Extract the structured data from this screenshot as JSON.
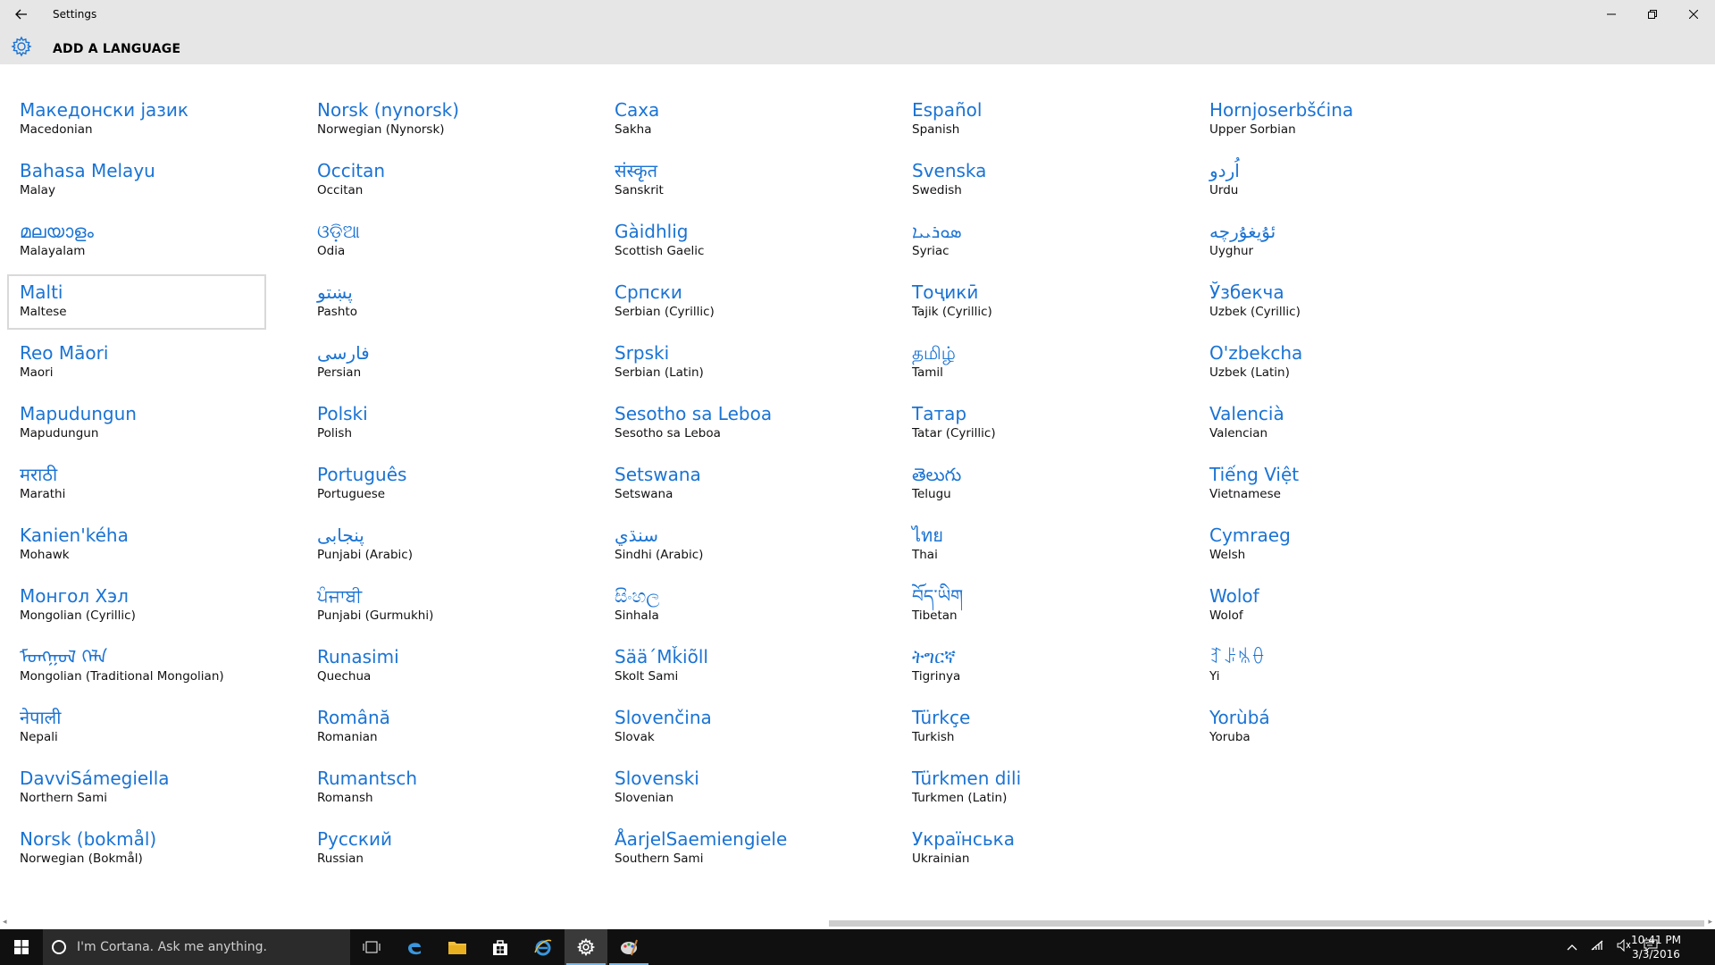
{
  "window": {
    "title": "Settings",
    "controls": {
      "minimize": "—",
      "restore": "❐",
      "close": "✕"
    }
  },
  "header": {
    "heading": "ADD A LANGUAGE"
  },
  "selected_index": 3,
  "languages": [
    {
      "native": "Македонски јазик",
      "english": "Macedonian"
    },
    {
      "native": "Bahasa Melayu",
      "english": "Malay"
    },
    {
      "native": "മലയാളം",
      "english": "Malayalam"
    },
    {
      "native": "Malti",
      "english": "Maltese"
    },
    {
      "native": "Reo Māori",
      "english": "Maori"
    },
    {
      "native": "Mapudungun",
      "english": "Mapudungun"
    },
    {
      "native": "मराठी",
      "english": "Marathi"
    },
    {
      "native": "Kanien'kéha",
      "english": "Mohawk"
    },
    {
      "native": "Монгол Хэл",
      "english": "Mongolian (Cyrillic)"
    },
    {
      "native": "ᠮᠣᠩᠭᠣᠯ ᠬᠡᠯᠡ",
      "english": "Mongolian (Traditional Mongolian)"
    },
    {
      "native": "नेपाली",
      "english": "Nepali"
    },
    {
      "native": "DavviSámegiella",
      "english": "Northern Sami"
    },
    {
      "native": "Norsk (bokmål)",
      "english": "Norwegian (Bokmål)"
    },
    {
      "native": "Norsk (nynorsk)",
      "english": "Norwegian (Nynorsk)"
    },
    {
      "native": "Occitan",
      "english": "Occitan"
    },
    {
      "native": "ଓଡ଼ିଆ",
      "english": "Odia"
    },
    {
      "native": "پښتو",
      "english": "Pashto"
    },
    {
      "native": "فارسی",
      "english": "Persian"
    },
    {
      "native": "Polski",
      "english": "Polish"
    },
    {
      "native": "Português",
      "english": "Portuguese"
    },
    {
      "native": "پنجابی",
      "english": "Punjabi (Arabic)"
    },
    {
      "native": "ਪੰਜਾਬੀ",
      "english": "Punjabi (Gurmukhi)"
    },
    {
      "native": "Runasimi",
      "english": "Quechua"
    },
    {
      "native": "Română",
      "english": "Romanian"
    },
    {
      "native": "Rumantsch",
      "english": "Romansh"
    },
    {
      "native": "Русский",
      "english": "Russian"
    },
    {
      "native": "Саха",
      "english": "Sakha"
    },
    {
      "native": "संस्कृत",
      "english": "Sanskrit"
    },
    {
      "native": "Gàidhlig",
      "english": "Scottish Gaelic"
    },
    {
      "native": "Српски",
      "english": "Serbian (Cyrillic)"
    },
    {
      "native": "Srpski",
      "english": "Serbian (Latin)"
    },
    {
      "native": "Sesotho sa Leboa",
      "english": "Sesotho sa Leboa"
    },
    {
      "native": "Setswana",
      "english": "Setswana"
    },
    {
      "native": "سنڌي",
      "english": "Sindhi (Arabic)"
    },
    {
      "native": "සිංහල",
      "english": "Sinhala"
    },
    {
      "native": "Sää´Mǩiõll",
      "english": "Skolt Sami"
    },
    {
      "native": "Slovenčina",
      "english": "Slovak"
    },
    {
      "native": "Slovenski",
      "english": "Slovenian"
    },
    {
      "native": "ÅarjelSaemiengiele",
      "english": "Southern Sami"
    },
    {
      "native": "Español",
      "english": "Spanish"
    },
    {
      "native": "Svenska",
      "english": "Swedish"
    },
    {
      "native": "ܣܘܪܝܝܐ",
      "english": "Syriac"
    },
    {
      "native": "Тоҷикӣ",
      "english": "Tajik (Cyrillic)"
    },
    {
      "native": "தமிழ்",
      "english": "Tamil"
    },
    {
      "native": "Татар",
      "english": "Tatar (Cyrillic)"
    },
    {
      "native": "తెలుగు",
      "english": "Telugu"
    },
    {
      "native": "ไทย",
      "english": "Thai"
    },
    {
      "native": "བོད་ཡིག",
      "english": "Tibetan"
    },
    {
      "native": "ትግርኛ",
      "english": "Tigrinya"
    },
    {
      "native": "Türkçe",
      "english": "Turkish"
    },
    {
      "native": "Türkmen dili",
      "english": "Turkmen (Latin)"
    },
    {
      "native": "Українська",
      "english": "Ukrainian"
    },
    {
      "native": "Hornjoserbšćina",
      "english": "Upper Sorbian"
    },
    {
      "native": "اُردو",
      "english": "Urdu"
    },
    {
      "native": "ئۇيغۇرچە",
      "english": "Uyghur"
    },
    {
      "native": "Ўзбекча",
      "english": "Uzbek (Cyrillic)"
    },
    {
      "native": "O'zbekcha",
      "english": "Uzbek (Latin)"
    },
    {
      "native": "Valencià",
      "english": "Valencian"
    },
    {
      "native": "Tiếng Việt",
      "english": "Vietnamese"
    },
    {
      "native": "Cymraeg",
      "english": "Welsh"
    },
    {
      "native": "Wolof",
      "english": "Wolof"
    },
    {
      "native": "ꆈꌠꁱꂷ",
      "english": "Yi"
    },
    {
      "native": "Yorùbá",
      "english": "Yoruba"
    }
  ],
  "taskbar": {
    "search_placeholder": "I'm Cortana. Ask me anything.",
    "time": "10:41 PM",
    "date": "3/3/2016"
  },
  "colors": {
    "accent": "#1a73d4",
    "chrome": "#e6e6e6",
    "taskbar": "#101010"
  }
}
